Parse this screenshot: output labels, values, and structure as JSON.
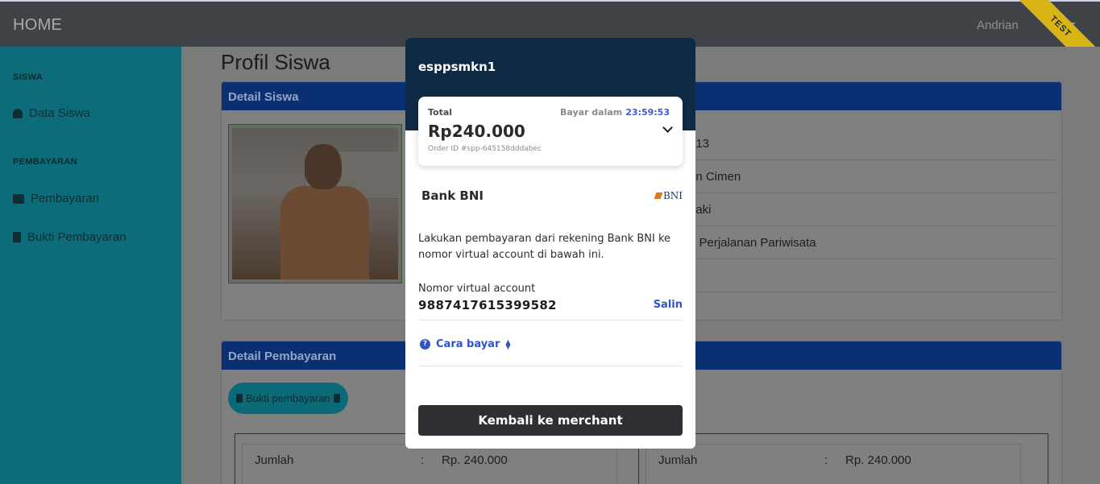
{
  "header": {
    "brand": "HOME",
    "user_name": "Andrian",
    "ribbon": "TEST"
  },
  "sidebar": {
    "section_siswa": "SISWA",
    "item_data_siswa": "Data Siswa",
    "section_pembayaran": "PEMBAYARAN",
    "item_pembayaran": "Pembayaran",
    "item_bukti": "Bukti Pembayaran"
  },
  "main": {
    "page_title": "Profil Siswa",
    "detail_siswa_title": "Detail Siswa",
    "detail_rows": [
      "313",
      "an Cimen",
      "Laki",
      "a Perjalanan Pariwisata",
      ""
    ],
    "detail_pembayaran_title": "Detail Pembayaran",
    "bukti_button": "Bukti pembayaran",
    "payment_rows": [
      {
        "label": "Jumlah",
        "sep": ":",
        "value": "Rp. 240.000"
      },
      {
        "label": "Jumlah",
        "sep": ":",
        "value": "Rp. 240.000"
      }
    ]
  },
  "modal": {
    "merchant": "esppsmkn1",
    "total_label": "Total",
    "pay_within_label": "Bayar dalam",
    "timer": "23:59:53",
    "amount": "Rp240.000",
    "order_id": "Order ID #spp-645158dddabec",
    "bank_name": "Bank BNI",
    "bank_logo_text": "BNI",
    "instruction": "Lakukan pembayaran dari rekening Bank BNI ke nomor virtual account di bawah ini.",
    "va_label": "Nomor virtual account",
    "va_number": "9887417615399582",
    "copy_label": "Salin",
    "how_to_pay": "Cara bayar",
    "back_button": "Kembali ke merchant"
  }
}
